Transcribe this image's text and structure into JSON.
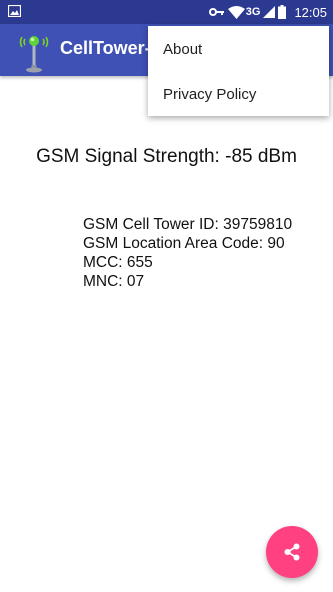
{
  "status_bar": {
    "time": "12:05",
    "network_type": "3G",
    "icons": [
      "image-notification-icon",
      "vpn-key-icon",
      "wifi-icon",
      "cell-signal-icon",
      "battery-icon"
    ]
  },
  "app_bar": {
    "title": "CellTower-",
    "logo_icon": "cell-tower-icon",
    "color": "#3f51b5"
  },
  "overflow_menu": {
    "items": [
      {
        "label": "About"
      },
      {
        "label": "Privacy Policy"
      }
    ]
  },
  "main": {
    "signal_strength": "GSM Signal Strength: -85 dBm",
    "info_lines": [
      "GSM Cell Tower ID: 39759810",
      "GSM Location Area Code: 90",
      "MCC: 655",
      "MNC: 07"
    ]
  },
  "fab": {
    "icon": "share-icon",
    "color": "#ff4081"
  }
}
